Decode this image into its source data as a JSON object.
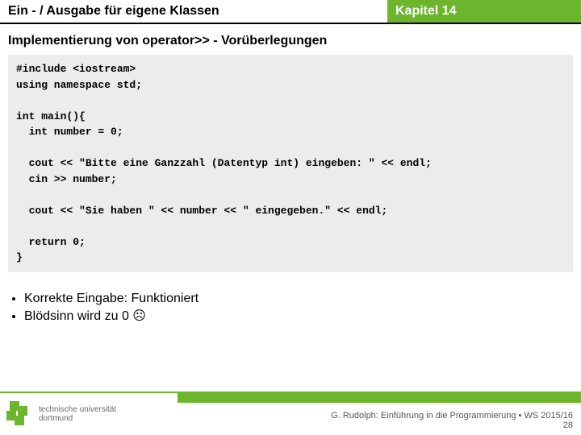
{
  "header": {
    "left": "Ein - / Ausgabe für eigene Klassen",
    "right": "Kapitel 14"
  },
  "subtitle": "Implementierung von operator>> - Vorüberlegungen",
  "code": "#include <iostream>\nusing namespace std;\n\nint main(){\n  int number = 0;\n\n  cout << \"Bitte eine Ganzzahl (Datentyp int) eingeben: \" << endl;\n  cin >> number;\n\n  cout << \"Sie haben \" << number << \" eingegeben.\" << endl;\n\n  return 0;\n}",
  "bullets": {
    "b1": "Korrekte Eingabe: Funktioniert",
    "b2": "Blödsinn wird zu 0 ☹"
  },
  "logo": {
    "line1": "technische universität",
    "line2": "dortmund"
  },
  "credit": {
    "text": "G. Rudolph: Einführung in die Programmierung ▪ WS 2015/16",
    "page": "28"
  }
}
